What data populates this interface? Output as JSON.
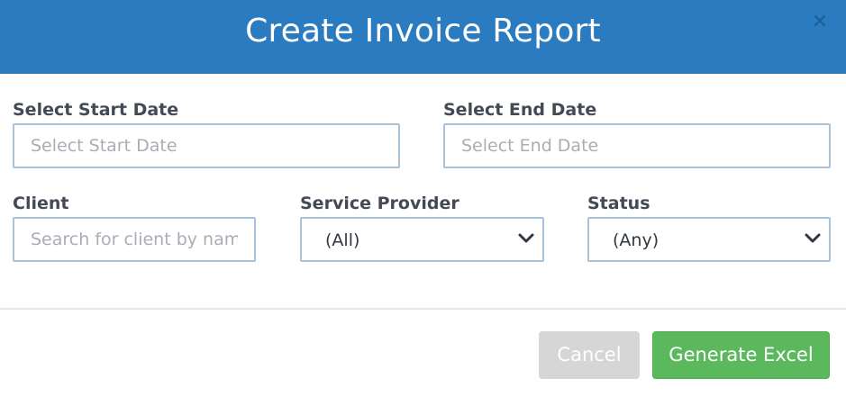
{
  "header": {
    "title": "Create Invoice Report",
    "close_icon": "close-icon",
    "color": "#2a7bc0"
  },
  "form": {
    "start_date": {
      "label": "Select Start Date",
      "placeholder": "Select Start Date",
      "value": ""
    },
    "end_date": {
      "label": "Select End Date",
      "placeholder": "Select End Date",
      "value": ""
    },
    "client": {
      "label": "Client",
      "placeholder": "Search for client by name",
      "value": ""
    },
    "service_provider": {
      "label": "Service Provider",
      "selected": "(All)",
      "icon": "chevron-down-icon"
    },
    "status": {
      "label": "Status",
      "selected": "(Any)",
      "icon": "chevron-down-icon"
    }
  },
  "footer": {
    "cancel_label": "Cancel",
    "generate_label": "Generate Excel",
    "generate_color": "#5cb85c",
    "cancel_color": "#d6d6d6"
  }
}
